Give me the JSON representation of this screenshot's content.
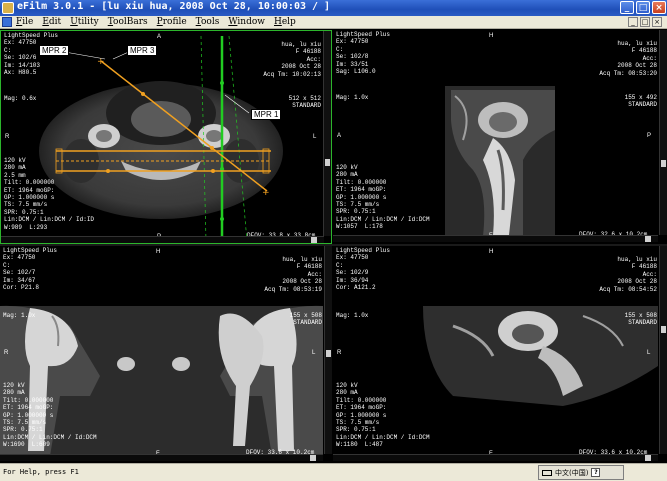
{
  "window": {
    "title": "eFilm 3.0.1 - [lu xiu hua, 2008 Oct 28, 10:00:03  /  ]",
    "min_label": "_",
    "max_label": "□",
    "close_label": "×"
  },
  "menu": {
    "items": [
      "File",
      "Edit",
      "Utility",
      "ToolBars",
      "Profile",
      "Tools",
      "Window",
      "Help"
    ],
    "mdi_min": "_",
    "mdi_restore": "□",
    "mdi_close": "×"
  },
  "viewports": [
    {
      "id": "vp1",
      "top_left": [
        "LightSpeed Plus",
        "Ex: 47750",
        "C:",
        "Se: 102/6",
        "Im: 14/103",
        "Ax: H80.5"
      ],
      "top_right": [
        "hua, lu xiu",
        "F 46188",
        "Acc:",
        "2008 Oct 28",
        "Acq Tm: 10:02:13",
        ""
      ],
      "mid_right": [
        "512 x 512",
        "STANDARD"
      ],
      "mag": "Mag: 0.6x",
      "bottom_left": [
        "120 kV",
        "280 mA",
        "2.5 mm",
        "Tilt: 0.000000",
        "ET: 1964 moGP:",
        "GP: 1.000000 s",
        "TS: 7.5 mm/s",
        "SPR: 0.75:1",
        "Lin:DCM / Lin:DCM / Id:ID",
        "W:989  L:293"
      ],
      "dfov": "DFOV: 33.8 x 33.8cm",
      "orient": {
        "top": "A",
        "left": "R",
        "right": "L",
        "bottom": "P"
      },
      "mpr_labels": {
        "mpr1": "MPR 1",
        "mpr2": "MPR 2",
        "mpr3": "MPR 3"
      }
    },
    {
      "id": "vp2",
      "top_left": [
        "LightSpeed Plus",
        "Ex: 47750",
        "C:",
        "Se: 102/8",
        "Im: 33/51",
        "Sag: L106.0"
      ],
      "top_right": [
        "hua, lu xiu",
        "F 46188",
        "Acc:",
        "2008 Oct 28",
        "Acq Tm: 08:53:20",
        ""
      ],
      "mid_right": [
        "155 x 492",
        "STANDARD"
      ],
      "mag": "Mag: 1.0x",
      "bottom_left": [
        "120 kV",
        "280 mA",
        "Tilt: 0.000000",
        "ET: 1964 moGP:",
        "GP: 1.000000 s",
        "TS: 7.5 mm/s",
        "SPR: 0.75:1",
        "Lin:DCM / Lin:DCM / Id:DCM",
        "W:1057  L:178"
      ],
      "dfov": "DFOV: 32.6 x 10.2cm",
      "orient": {
        "top": "H",
        "left": "A",
        "right": "P",
        "bottom": "F"
      }
    },
    {
      "id": "vp3",
      "top_left": [
        "LightSpeed Plus",
        "Ex: 47750",
        "C:",
        "Se: 102/7",
        "Im: 34/67",
        "Cor: P21.8"
      ],
      "top_right": [
        "hua, lu xiu",
        "F 46188",
        "Acc:",
        "2008 Oct 28",
        "Acq Tm: 08:53:19",
        ""
      ],
      "mid_right": [
        "155 x 508",
        "STANDARD"
      ],
      "mag": "Mag: 1.0x",
      "bottom_left": [
        "120 kV",
        "280 mA",
        "Tilt: 0.000000",
        "ET: 1964 moGP:",
        "GP: 1.000000 s",
        "TS: 7.5 mm/s",
        "SPR: 0.75:1",
        "Lin:DCM / Lin:DCM / Id:DCM",
        "W:1690  L:609"
      ],
      "dfov": "DFOV: 33.6 x 10.2cm",
      "orient": {
        "top": "H",
        "left": "R",
        "right": "L",
        "bottom": "F"
      }
    },
    {
      "id": "vp4",
      "top_left": [
        "LightSpeed Plus",
        "Ex: 47750",
        "C:",
        "Se: 102/9",
        "Im: 36/94",
        "Cor: A121.2"
      ],
      "top_right": [
        "hua, lu xiu",
        "F 46188",
        "Acc:",
        "2008 Oct 28",
        "Acq Tm: 08:54:52",
        ""
      ],
      "mid_right": [
        "155 x 508",
        "STANDARD"
      ],
      "mag": "Mag: 1.0x",
      "bottom_left": [
        "120 kV",
        "280 mA",
        "Tilt: 0.000000",
        "ET: 1964 moGP:",
        "GP: 1.000000 s",
        "TS: 7.5 mm/s",
        "SPR: 0.75:1",
        "Lin:DCM / Lin:DCM / Id:DCM",
        "W:1180  L:487"
      ],
      "dfov": "DFOV: 33.6 x 10.2cm",
      "orient": {
        "top": "H",
        "left": "R",
        "right": "L",
        "bottom": "F"
      }
    }
  ],
  "colors": {
    "mpr_orange": "#f0a020",
    "mpr_green": "#22cc22",
    "viewport_border": "#2cb52c"
  },
  "status": {
    "help_text": "For Help, press F1",
    "ime_label": "中文(中国)",
    "ime_help": "?"
  }
}
